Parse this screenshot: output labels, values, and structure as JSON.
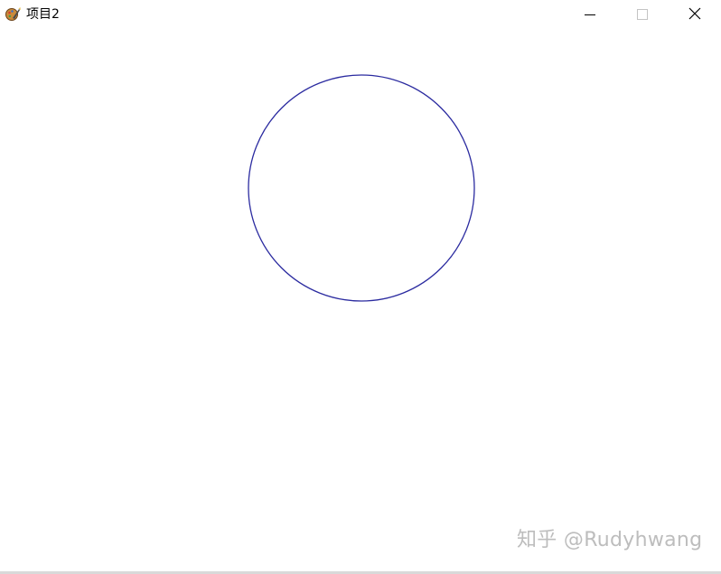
{
  "window": {
    "title": "项目2"
  },
  "titlebar": {
    "icons": {
      "app": "paint-brush-icon",
      "minimize": "minimize-icon",
      "maximize": "maximize-icon",
      "close": "close-icon"
    }
  },
  "canvas": {
    "shape": "circle",
    "stroke_color": "#2b2ba0",
    "background": "#ffffff"
  },
  "watermark": {
    "text": "知乎 @Rudyhwang"
  }
}
